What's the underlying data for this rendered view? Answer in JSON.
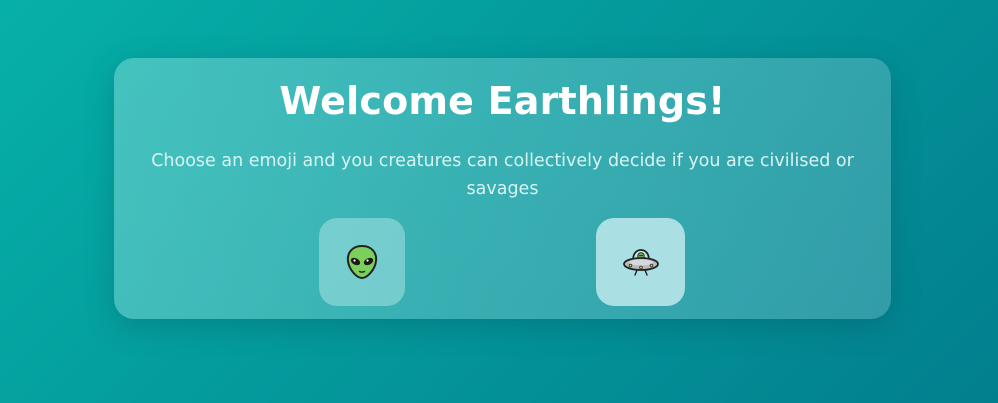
{
  "card": {
    "title": "Welcome Earthlings!",
    "subtitle": "Choose an emoji and you creatures can collectively decide if you are civilised or savages"
  },
  "options": [
    {
      "icon": "alien-icon",
      "label": "alien"
    },
    {
      "icon": "ufo-icon",
      "label": "flying saucer"
    }
  ],
  "colors": {
    "background_start": "#06b0a8",
    "background_end": "#027f8e",
    "title": "#ffffff",
    "subtitle": "#d8f3f2"
  }
}
